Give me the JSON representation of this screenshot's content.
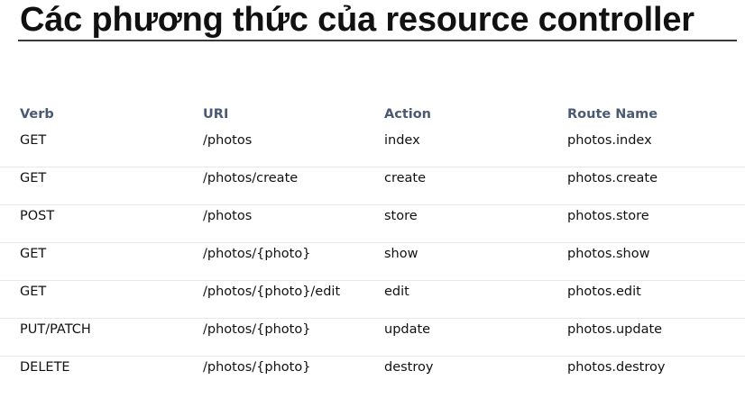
{
  "title": "Các phương thức của resource controller",
  "table": {
    "headers": [
      "Verb",
      "URI",
      "Action",
      "Route Name"
    ],
    "rows": [
      [
        "GET",
        "/photos",
        "index",
        "photos.index"
      ],
      [
        "GET",
        "/photos/create",
        "create",
        "photos.create"
      ],
      [
        "POST",
        "/photos",
        "store",
        "photos.store"
      ],
      [
        "GET",
        "/photos/{photo}",
        "show",
        "photos.show"
      ],
      [
        "GET",
        "/photos/{photo}/edit",
        "edit",
        "photos.edit"
      ],
      [
        "PUT/PATCH",
        "/photos/{photo}",
        "update",
        "photos.update"
      ],
      [
        "DELETE",
        "/photos/{photo}",
        "destroy",
        "photos.destroy"
      ]
    ]
  },
  "colors": {
    "header_text": "#4a5a73",
    "body_text": "#111111",
    "row_divider": "#e9e9e9"
  }
}
